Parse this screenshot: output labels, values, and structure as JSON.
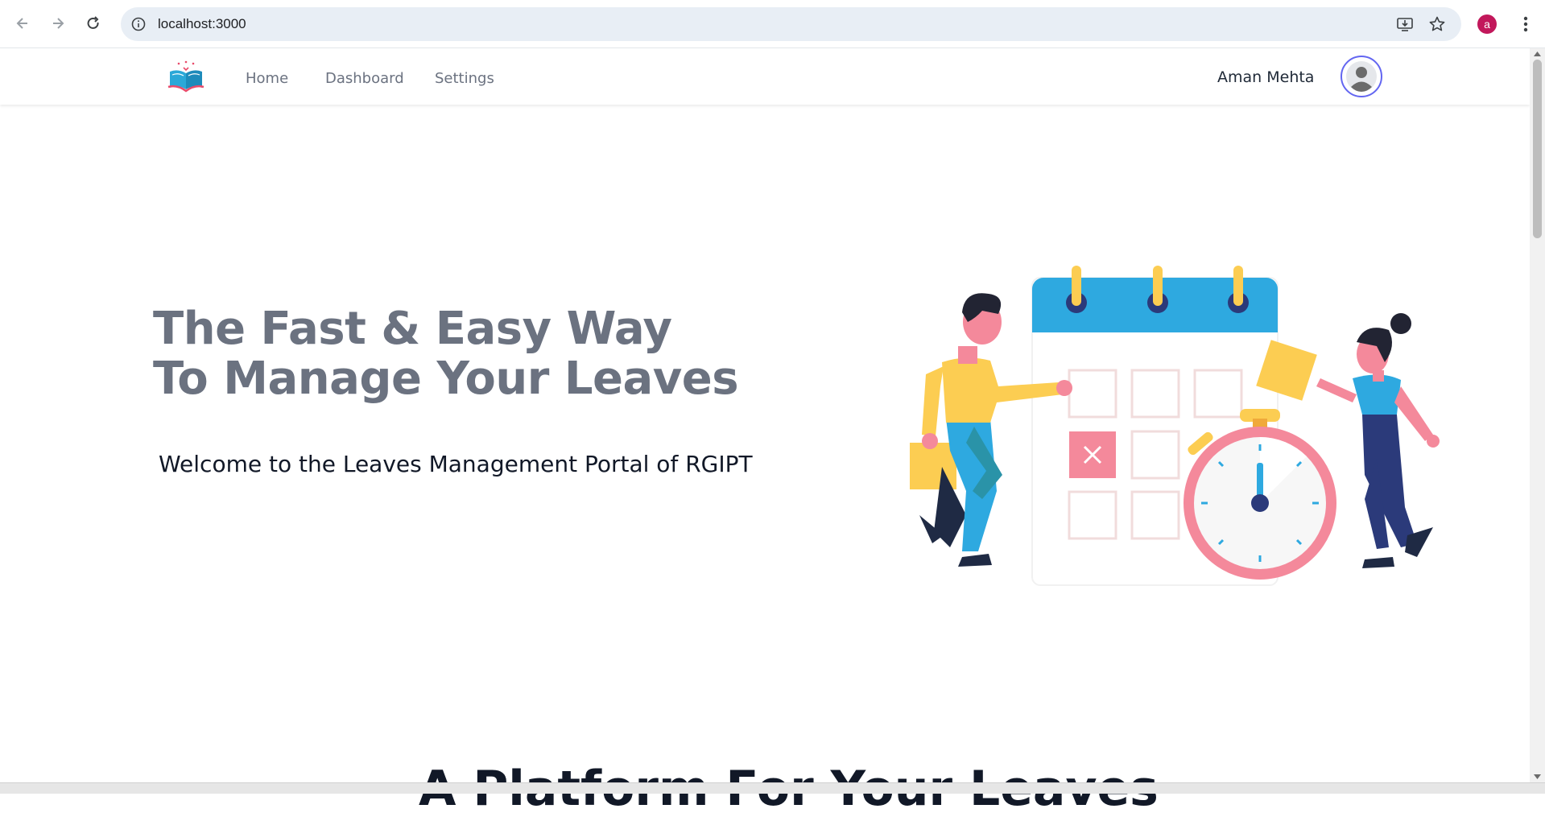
{
  "browser": {
    "url": "localhost:3000",
    "profile_initial": "a"
  },
  "navbar": {
    "links": [
      "Home",
      "Dashboard",
      "Settings"
    ],
    "user_name": "Aman Mehta"
  },
  "hero": {
    "title_line1": "The Fast & Easy Way",
    "title_line2": "To Manage Your Leaves",
    "subtitle": "Welcome to the Leaves Management Portal of RGIPT"
  },
  "next_section": {
    "title": "A Platform For Your Leaves"
  },
  "colors": {
    "accent": "#6366f1",
    "nav_text": "#6b7280",
    "calendar_blue": "#2ea9e0",
    "yellow": "#fccd52",
    "pink": "#f4899b"
  }
}
